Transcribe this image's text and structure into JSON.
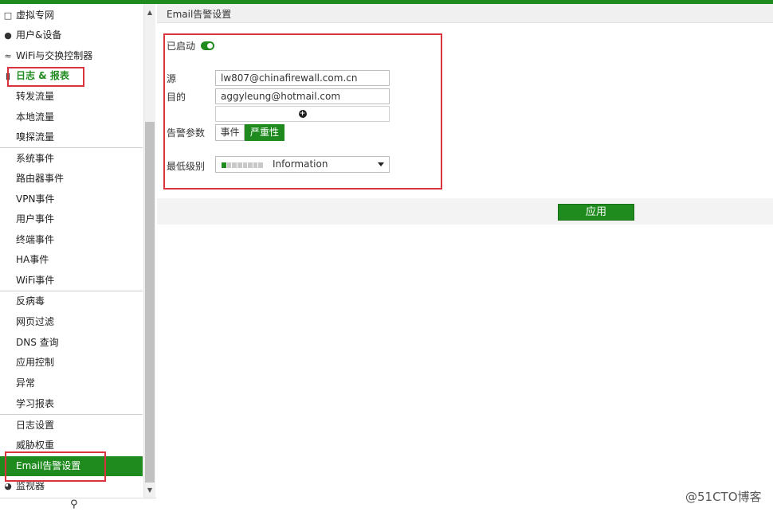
{
  "colors": {
    "accent": "#1f8b1f",
    "highlight_box": "#d9343d"
  },
  "sidebar": {
    "items": [
      {
        "label": "虚拟专网",
        "icon": "monitor-icon"
      },
      {
        "label": "用户&设备",
        "icon": "user-icon"
      },
      {
        "label": "WiFi与交换控制器",
        "icon": "wifi-icon"
      },
      {
        "label": "日志 & 报表",
        "icon": "chart-icon"
      },
      {
        "label": "转发流量"
      },
      {
        "label": "本地流量"
      },
      {
        "label": "嗅探流量"
      },
      {
        "label": "系统事件"
      },
      {
        "label": "路由器事件"
      },
      {
        "label": "VPN事件"
      },
      {
        "label": "用户事件"
      },
      {
        "label": "终端事件"
      },
      {
        "label": "HA事件"
      },
      {
        "label": "WiFi事件"
      },
      {
        "label": "反病毒"
      },
      {
        "label": "网页过滤"
      },
      {
        "label": "DNS 查询"
      },
      {
        "label": "应用控制"
      },
      {
        "label": "异常"
      },
      {
        "label": "学习报表"
      },
      {
        "label": "日志设置"
      },
      {
        "label": "威胁权重"
      },
      {
        "label": "Email告警设置"
      },
      {
        "label": "监视器",
        "icon": "pie-chart-icon"
      }
    ],
    "search_icon": "search-icon"
  },
  "main": {
    "title": "Email告警设置",
    "enabled_label": "已启动",
    "enabled": true,
    "source_label": "源",
    "source_value": "lw807@chinafirewall.com.cn",
    "dest_label": "目的",
    "dest_value": "aggyleung@hotmail.com",
    "params_label": "告警参数",
    "params_options": [
      "事件",
      "严重性"
    ],
    "params_selected": "严重性",
    "min_level_label": "最低级别",
    "min_level_value": "Information",
    "min_level_fill": 0.125,
    "apply_label": "应用"
  },
  "watermark": "@51CTO博客"
}
